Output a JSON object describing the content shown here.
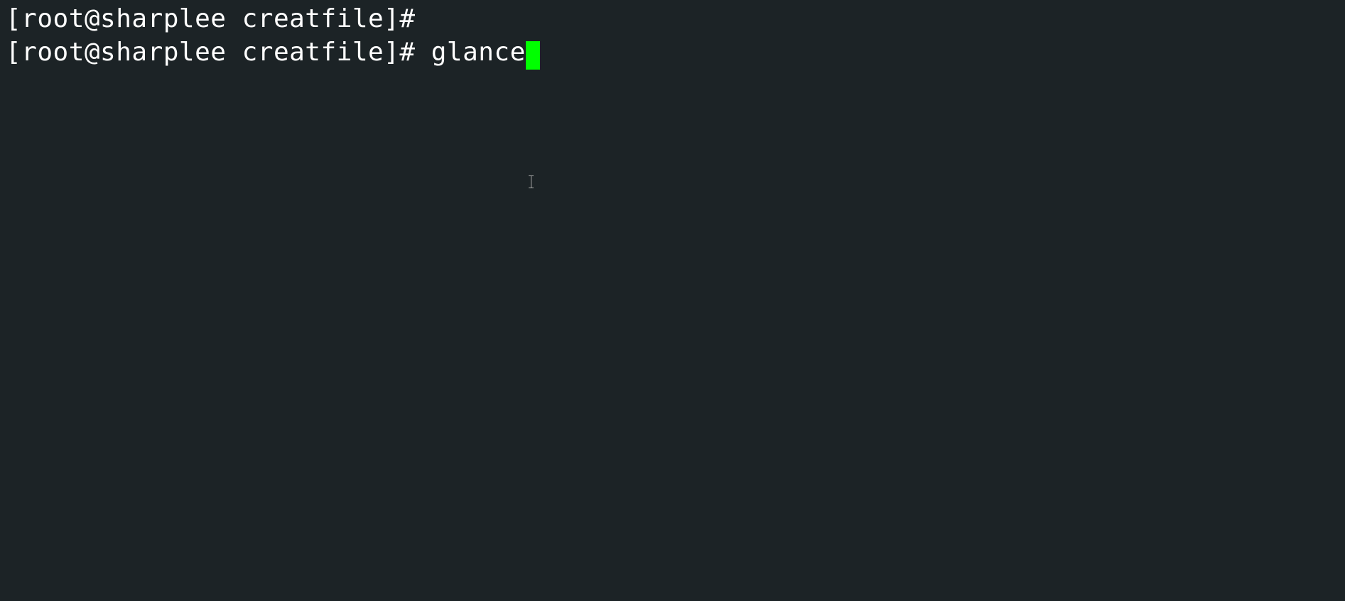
{
  "terminal": {
    "lines": [
      {
        "prompt": "[root@sharplee creatfile]#",
        "command": ""
      },
      {
        "prompt": "[root@sharplee creatfile]#",
        "command": "glance"
      }
    ],
    "cursor_color": "#00ff00",
    "background_color": "#1c2326",
    "text_color": "#ffffff"
  }
}
